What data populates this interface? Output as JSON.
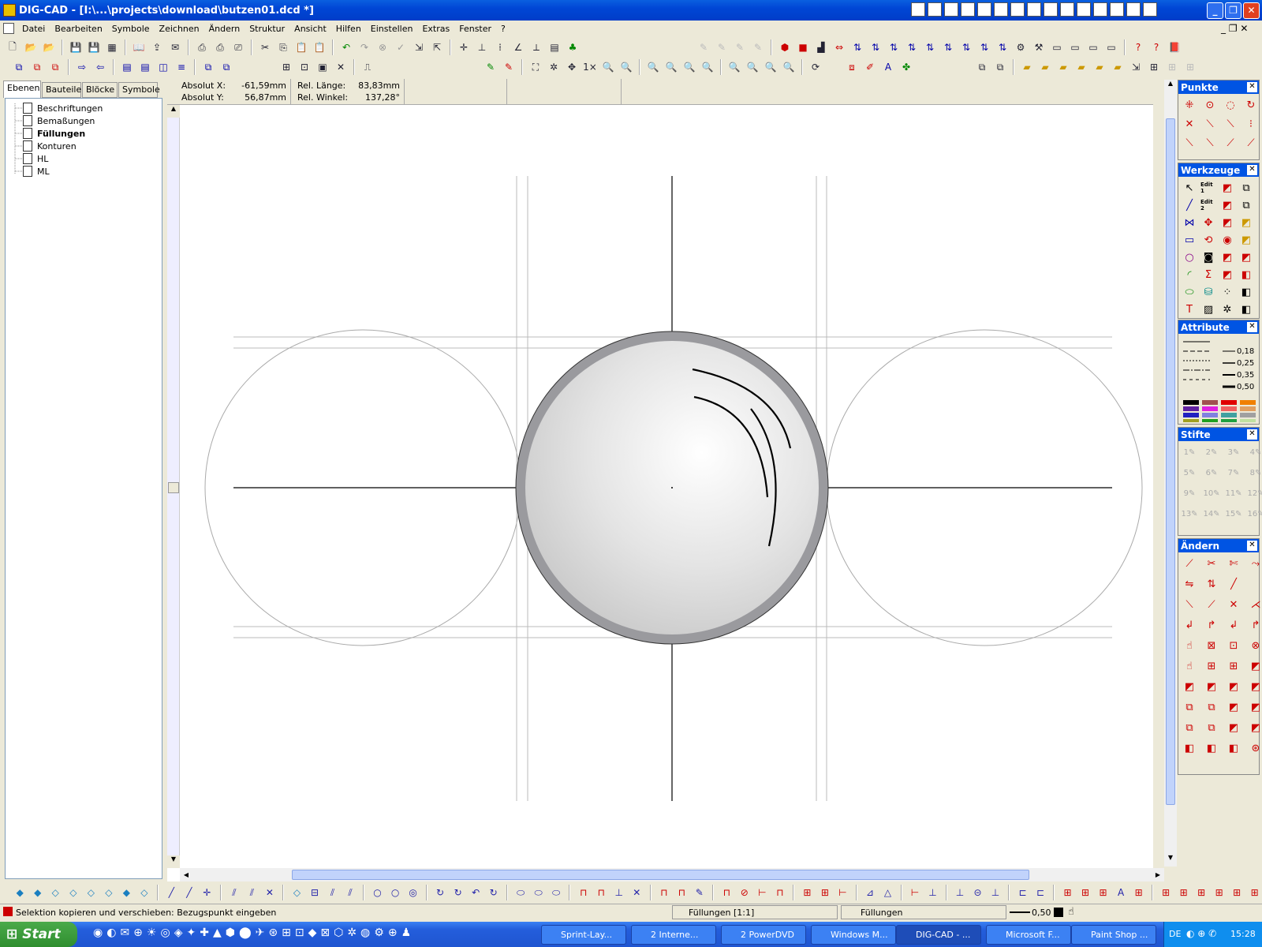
{
  "window": {
    "title": "DIG-CAD - [I:\\...\\projects\\download\\butzen01.dcd *]"
  },
  "menu": [
    "Datei",
    "Bearbeiten",
    "Symbole",
    "Zeichnen",
    "Ändern",
    "Struktur",
    "Ansicht",
    "Hilfen",
    "Einstellen",
    "Extras",
    "Fenster",
    "?"
  ],
  "left_tabs": [
    "Ebenen",
    "Bauteile",
    "Blöcke",
    "Symbole"
  ],
  "layers": [
    "Beschriftungen",
    "Bemaßungen",
    "Füllungen",
    "Konturen",
    "HL",
    "ML"
  ],
  "active_layer": "Füllungen",
  "coords": {
    "abs_x_label": "Absolut X:",
    "abs_x_value": "-61,59mm",
    "abs_y_label": "Absolut Y:",
    "abs_y_value": "56,87mm",
    "rel_len_label": "Rel. Länge:",
    "rel_len_value": "83,83mm",
    "rel_angle_label": "Rel. Winkel:",
    "rel_angle_value": "137,28°"
  },
  "palettes": {
    "punkte": "Punkte",
    "werkzeuge": "Werkzeuge",
    "attribute": "Attribute",
    "stifte": "Stifte",
    "aendern": "Ändern",
    "line_widths": [
      "0,18",
      "0,25",
      "0,35",
      "0,50"
    ],
    "edit1": "Edit 1",
    "edit2": "Edit 2",
    "pens": [
      "1",
      "2",
      "3",
      "4",
      "5",
      "6",
      "7",
      "8",
      "9",
      "10",
      "11",
      "12",
      "13",
      "14",
      "15",
      "16"
    ]
  },
  "status": {
    "message": "Selektion kopieren und verschieben: Bezugspunkt eingeben",
    "layer_scale": "Füllungen [1:1]",
    "fill": "Füllungen",
    "line_width": "0,50"
  },
  "taskbar": {
    "start": "Start",
    "tasks": [
      "Sprint-Lay...",
      "2 Interne...",
      "2 PowerDVD",
      "Windows M...",
      "DIG-CAD - ...",
      "Microsoft F...",
      "Paint Shop ..."
    ],
    "active_task": "DIG-CAD - ...",
    "lang": "DE",
    "clock": "15:28"
  },
  "colors": {
    "accent": "#0054E3",
    "canvas": "#FFFFFF",
    "face": "#ECE9D8"
  },
  "swatches": [
    "#000000",
    "#A05050",
    "#E00000",
    "#F08000",
    "#6020A0",
    "#E020E0",
    "#F06060",
    "#E0A060",
    "#2020C0",
    "#8080E0",
    "#40A0A0",
    "#A0A0A0",
    "#A0A020",
    "#20A020",
    "#20A040",
    "#C0E0A0"
  ]
}
